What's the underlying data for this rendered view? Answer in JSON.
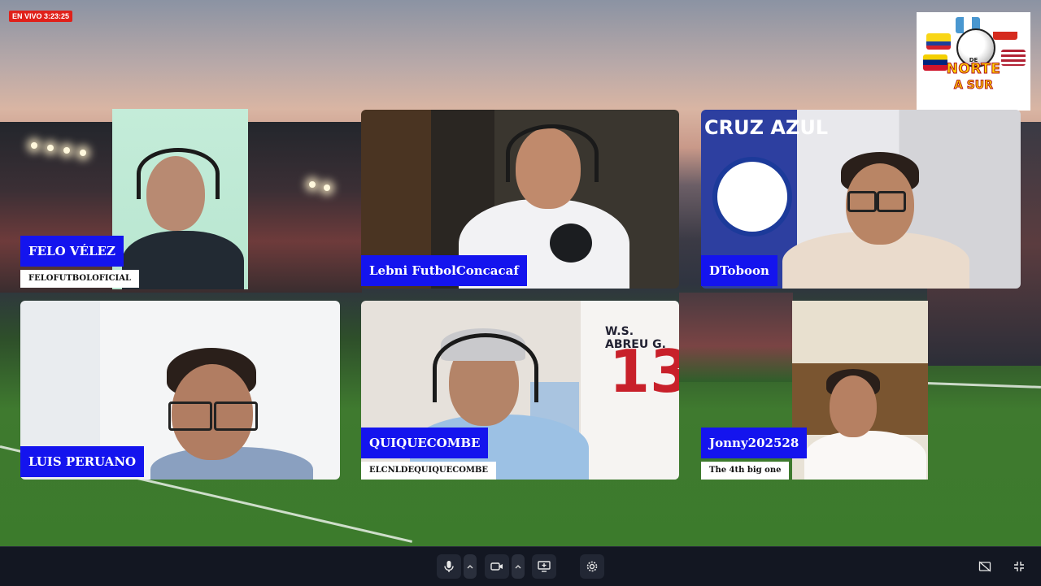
{
  "live": {
    "text": "EN VIVO 3:23:25"
  },
  "logo": {
    "line_de": "DE",
    "line1": "NORTE",
    "line2": "A SUR"
  },
  "participants": [
    {
      "name": "FELO VÉLEZ",
      "subtitle": "FELOFUTBOLOFICIAL"
    },
    {
      "name": "Lebni FutbolConcacaf",
      "subtitle": ""
    },
    {
      "name": "DToboon",
      "subtitle": ""
    },
    {
      "name": "LUIS PERUANO",
      "subtitle": ""
    },
    {
      "name": "QUIQUECOMBE",
      "subtitle": "ELCNLDEQUIQUECOMBE"
    },
    {
      "name": "Jonny202528",
      "subtitle": "The 4th big one"
    }
  ],
  "jersey": {
    "name": "W.S. ABREU G.",
    "number": "13"
  },
  "banner": {
    "text": "CRUZ AZUL"
  },
  "toolbar": {
    "icons": [
      "microphone-icon",
      "chevron-up-icon",
      "camera-icon",
      "chevron-up-icon",
      "share-screen-icon",
      "settings-icon",
      "hide-self-view-icon",
      "exit-fullscreen-icon"
    ]
  },
  "colors": {
    "name_label_bg": "#1414ee",
    "subtitle_bg": "#ffffff",
    "live_badge": "#e0211a",
    "toolbar_bg": "#131722"
  }
}
